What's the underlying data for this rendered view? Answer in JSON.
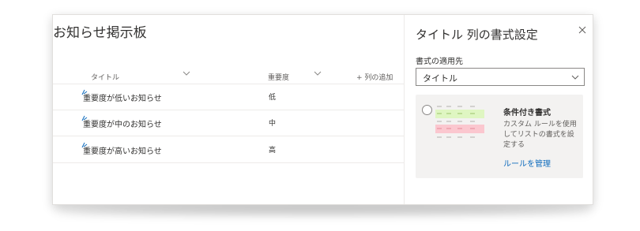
{
  "list": {
    "title": "お知らせ掲示板",
    "columns": {
      "title": "タイトル",
      "priority": "重要度",
      "add_column": "+ 列の追加"
    },
    "rows": [
      {
        "title": "重要度が低いお知らせ",
        "priority": "低"
      },
      {
        "title": "重要度が中のお知らせ",
        "priority": "中"
      },
      {
        "title": "重要度が高いお知らせ",
        "priority": "高"
      }
    ]
  },
  "panel": {
    "title": "タイトル 列の書式設定",
    "close_icon": "close-icon",
    "apply_label": "書式の適用先",
    "apply_value": "タイトル",
    "conditional": {
      "heading": "条件付き書式",
      "description": "カスタム ルールを使用してリストの書式を設定する",
      "link": "ルールを管理"
    }
  },
  "colors": {
    "accent_link": "#0f6cbd",
    "new_marker": "#0f6cbd",
    "preview_green": "#dff6c2",
    "preview_red": "#fbc7cf"
  }
}
